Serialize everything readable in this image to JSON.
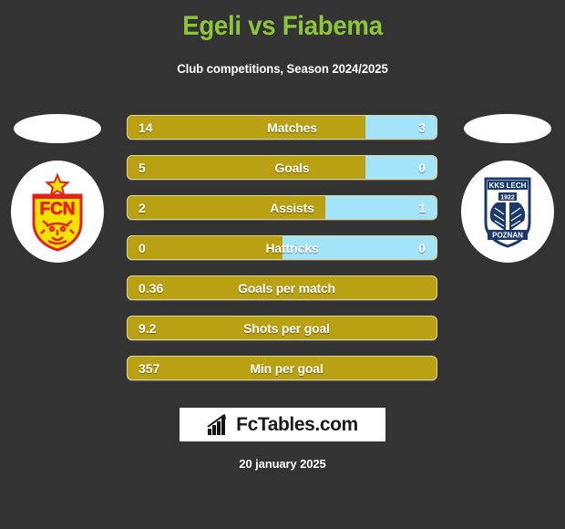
{
  "header": {
    "title": "Egeli vs Fiabema",
    "subtitle": "Club competitions, Season 2024/2025",
    "title_color": "#8cc63e"
  },
  "theme": {
    "background": "#333333",
    "home_bar_color": "#b9a113",
    "away_bar_color": "#a3e4fb",
    "text_color": "#ffffff"
  },
  "badges": {
    "home": {
      "name": "fc-nordsjaelland",
      "initials": "FCN",
      "primary_color": "#f2e200",
      "secondary_color": "#e2231a"
    },
    "away": {
      "name": "lech-poznan",
      "line1": "KKS LECH",
      "line2": "1922",
      "line3": "POZNAN",
      "primary_color": "#1b3a6b",
      "secondary_color": "#ffffff"
    }
  },
  "comparison_stats": [
    {
      "label": "Matches",
      "home": "14",
      "away": "3",
      "home_pct": 77
    },
    {
      "label": "Goals",
      "home": "5",
      "away": "0",
      "home_pct": 77
    },
    {
      "label": "Assists",
      "home": "2",
      "away": "1",
      "home_pct": 64
    },
    {
      "label": "Hattricks",
      "home": "0",
      "away": "0",
      "home_pct": 50
    }
  ],
  "single_stats": [
    {
      "label": "Goals per match",
      "value": "0.36"
    },
    {
      "label": "Shots per goal",
      "value": "9.2"
    },
    {
      "label": "Min per goal",
      "value": "357"
    }
  ],
  "footer": {
    "logo_text": "FcTables.com",
    "logo_icon": "bar-chart-icon",
    "date": "20 january 2025"
  }
}
